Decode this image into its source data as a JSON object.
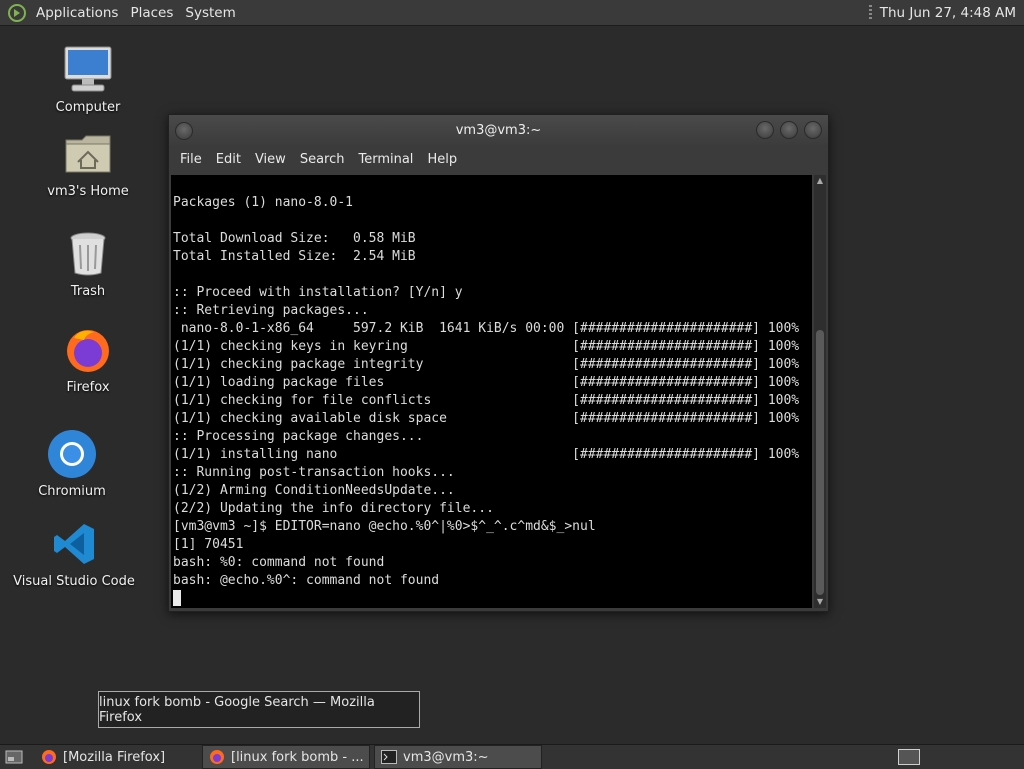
{
  "top_panel": {
    "menus": [
      "Applications",
      "Places",
      "System"
    ],
    "clock": "Thu Jun 27,  4:48 AM"
  },
  "desktop_icons": [
    {
      "label": "Computer",
      "icon": "computer-icon"
    },
    {
      "label": "vm3's Home",
      "icon": "home-folder-icon"
    },
    {
      "label": "Trash",
      "icon": "trash-icon"
    },
    {
      "label": "Firefox",
      "icon": "firefox-icon"
    },
    {
      "label": "Chromium",
      "icon": "chromium-icon"
    },
    {
      "label": "Visual Studio Code",
      "icon": "vscode-icon"
    }
  ],
  "terminal": {
    "title": "vm3@vm3:~",
    "menu": [
      "File",
      "Edit",
      "View",
      "Search",
      "Terminal",
      "Help"
    ],
    "lines": [
      "Packages (1) nano-8.0-1",
      "",
      "Total Download Size:   0.58 MiB",
      "Total Installed Size:  2.54 MiB",
      "",
      ":: Proceed with installation? [Y/n] y",
      ":: Retrieving packages...",
      " nano-8.0-1-x86_64     597.2 KiB  1641 KiB/s 00:00 [######################] 100%",
      "(1/1) checking keys in keyring                     [######################] 100%",
      "(1/1) checking package integrity                   [######################] 100%",
      "(1/1) loading package files                        [######################] 100%",
      "(1/1) checking for file conflicts                  [######################] 100%",
      "(1/1) checking available disk space                [######################] 100%",
      ":: Processing package changes...",
      "(1/1) installing nano                              [######################] 100%",
      ":: Running post-transaction hooks...",
      "(1/2) Arming ConditionNeedsUpdate...",
      "(2/2) Updating the info directory file...",
      "[vm3@vm3 ~]$ EDITOR=nano @echo.%0^|%0>$^_^.c^md&$_>nul",
      "[1] 70451",
      "bash: %0: command not found",
      "bash: @echo.%0^: command not found"
    ]
  },
  "tooltip": "linux fork bomb - Google Search — Mozilla Firefox",
  "taskbar": {
    "tasks": [
      {
        "label": "[Mozilla Firefox]",
        "icon": "firefox-icon",
        "active": false
      },
      {
        "label": "[linux fork bomb - ...",
        "icon": "firefox-icon",
        "active": true
      },
      {
        "label": "vm3@vm3:~",
        "icon": "terminal-icon",
        "active": true
      }
    ]
  }
}
